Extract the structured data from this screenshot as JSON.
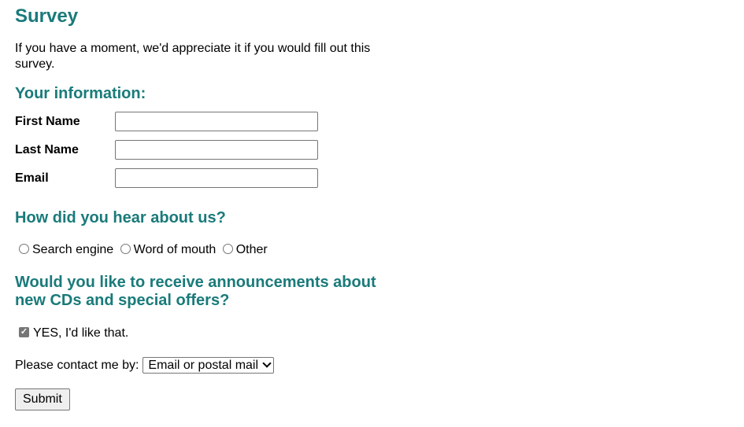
{
  "colors": {
    "heading": "#1a7a7a",
    "text": "#000000",
    "input_border": "#767676",
    "button_bg": "#efefef"
  },
  "page": {
    "title": "Survey",
    "intro": "If you have a moment, we'd appreciate it if you would fill out this survey."
  },
  "info_section": {
    "heading": "Your information:",
    "fields": [
      {
        "label": "First Name",
        "value": ""
      },
      {
        "label": "Last Name",
        "value": ""
      },
      {
        "label": "Email",
        "value": ""
      }
    ]
  },
  "hear_section": {
    "heading": "How did you hear about us?",
    "options": [
      "Search engine",
      "Word of mouth",
      "Other"
    ]
  },
  "announce_section": {
    "heading": "Would you like to receive announcements about new CDs and special offers?",
    "checkbox_label": "YES, I'd like that.",
    "checkbox_checked": true,
    "contact_label": "Please contact me by:",
    "contact_selected": "Email or postal mail"
  },
  "submit_label": "Submit"
}
